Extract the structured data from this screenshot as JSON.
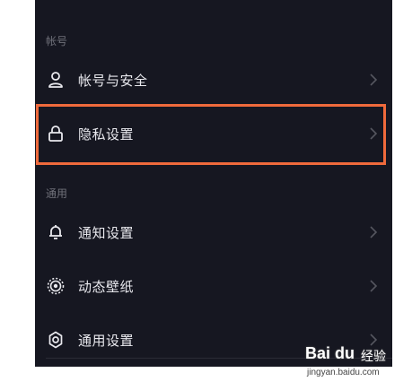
{
  "sections": {
    "account": {
      "title": "帐号",
      "items": [
        {
          "label": "帐号与安全",
          "icon": "person-icon"
        },
        {
          "label": "隐私设置",
          "icon": "lock-icon"
        }
      ]
    },
    "general": {
      "title": "通用",
      "items": [
        {
          "label": "通知设置",
          "icon": "bell-icon"
        },
        {
          "label": "动态壁纸",
          "icon": "target-icon"
        },
        {
          "label": "通用设置",
          "icon": "gear-icon"
        }
      ]
    }
  },
  "highlight_color": "#ef6a3c",
  "watermark": {
    "brand": "Bai du",
    "product": "经验",
    "url": "jingyan.baidu.com"
  }
}
